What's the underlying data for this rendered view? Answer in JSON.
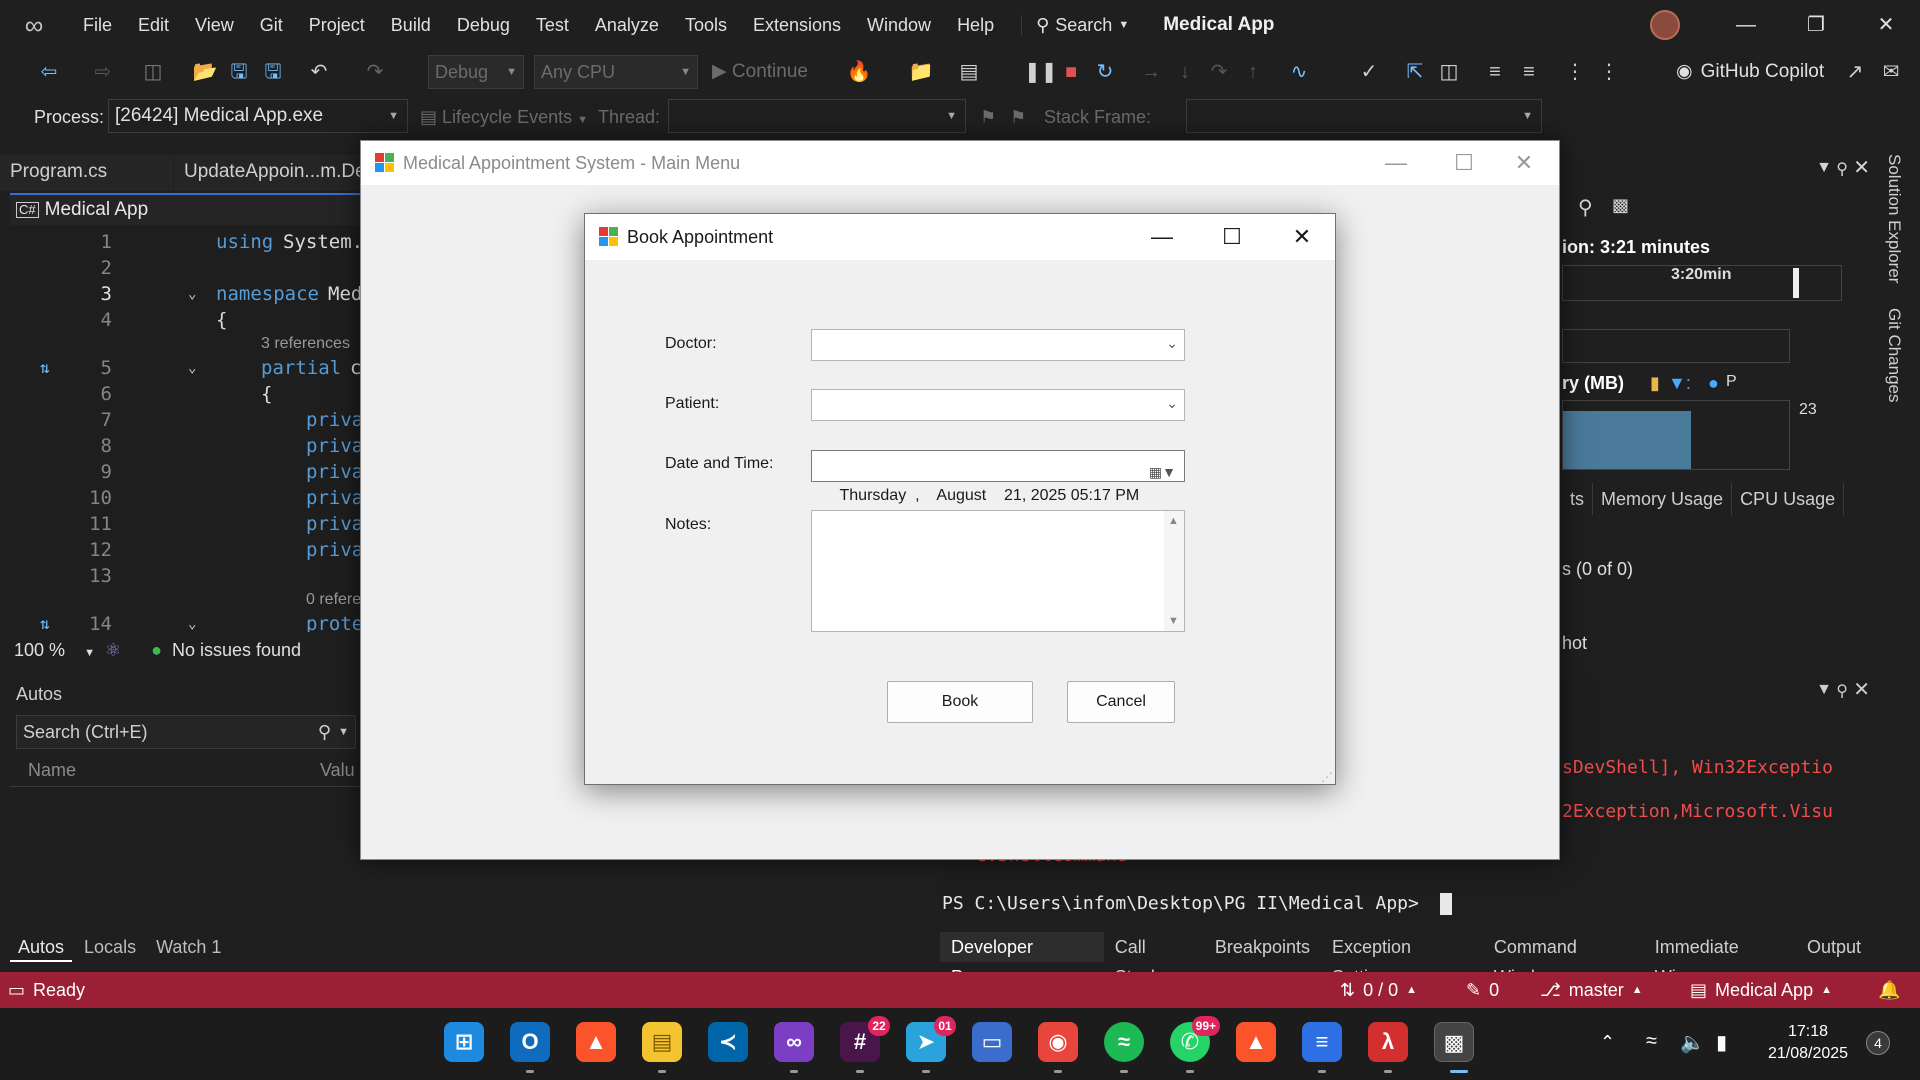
{
  "menu": {
    "items": [
      "File",
      "Edit",
      "View",
      "Git",
      "Project",
      "Build",
      "Debug",
      "Test",
      "Analyze",
      "Tools",
      "Extensions",
      "Window",
      "Help"
    ],
    "search_label": "Search",
    "solution_name": "Medical App"
  },
  "toolbar": {
    "config": "Debug",
    "platform": "Any CPU",
    "continue_label": "Continue",
    "copilot_label": "GitHub Copilot"
  },
  "processbar": {
    "process_label": "Process:",
    "process_value": "[26424] Medical App.exe",
    "lifecycle_label": "Lifecycle Events",
    "thread_label": "Thread:",
    "stack_frame_label": "Stack Frame:"
  },
  "editor": {
    "tabs": [
      "Program.cs",
      "UpdateAppoin...m.De"
    ],
    "project_nav": "Medical App",
    "lines": [
      {
        "num": "1",
        "kw": "using",
        "text": " System."
      },
      {
        "num": "2",
        "kw": "",
        "text": ""
      },
      {
        "num": "3",
        "kw": "namespace",
        "text": " Med"
      },
      {
        "num": "4",
        "kw": "",
        "text": "{"
      },
      {
        "num": "5",
        "kw": "partial",
        "text": " c"
      },
      {
        "num": "6",
        "kw": "",
        "text": "{"
      },
      {
        "num": "7",
        "kw": "priva",
        "text": ""
      },
      {
        "num": "8",
        "kw": "priva",
        "text": ""
      },
      {
        "num": "9",
        "kw": "priva",
        "text": ""
      },
      {
        "num": "10",
        "kw": "priva",
        "text": ""
      },
      {
        "num": "11",
        "kw": "priva",
        "text": ""
      },
      {
        "num": "12",
        "kw": "priva",
        "text": ""
      },
      {
        "num": "13",
        "kw": "",
        "text": ""
      },
      {
        "num": "14",
        "kw": "prote",
        "text": ""
      }
    ],
    "codelens_1": "3 references",
    "codelens_2": "0 refere",
    "zoom": "100 %",
    "issues": "No issues found"
  },
  "autos": {
    "title": "Autos",
    "search_placeholder": "Search (Ctrl+E)",
    "col_name": "Name",
    "col_value": "Valu",
    "tabs": [
      "Autos",
      "Locals",
      "Watch 1"
    ]
  },
  "diagnostics": {
    "session_text": "ion: 3:21 minutes",
    "timeline_label": "3:20min",
    "memory_label": "ry (MB)",
    "legend_p": "P",
    "memory_value": "23",
    "tabs": [
      "ts",
      "Memory Usage",
      "CPU Usage"
    ],
    "events_text": "s (0 of 0)",
    "snapshot_text": "hot",
    "rail_1": "Solution Explorer",
    "rail_2": "Git Changes"
  },
  "terminal": {
    "err_1": "sDevShell], Win32Exceptio",
    "err_2": "2Exception,Microsoft.Visu",
    "err_3": "evShellCommand",
    "prompt": "PS C:\\Users\\infom\\Desktop\\PG II\\Medical App>",
    "tabs": [
      "Developer Powe...",
      "Call Stack",
      "Breakpoints",
      "Exception Settin...",
      "Command Wind...",
      "Immediate Win...",
      "Output"
    ]
  },
  "statusbar": {
    "ready": "Ready",
    "changes": "0 / 0",
    "edits": "0",
    "branch": "master",
    "project": "Medical App"
  },
  "taskbar": {
    "badge_slack": "22",
    "badge_telegram": "01",
    "badge_whatsapp": "99+",
    "time": "17:18",
    "date": "21/08/2025",
    "notifications": "4"
  },
  "main_form": {
    "title": "Medical Appointment System - Main Menu"
  },
  "book_dialog": {
    "title": "Book Appointment",
    "doctor_label": "Doctor:",
    "doctor_value": "",
    "patient_label": "Patient:",
    "patient_value": "",
    "datetime_label": "Date and Time:",
    "datetime_value": "Thursday  ,    August    21, 2025 05:17 PM",
    "notes_label": "Notes:",
    "notes_value": "",
    "book_button": "Book",
    "cancel_button": "Cancel"
  },
  "colors": {
    "statusbar_bg": "#9b1f35",
    "keyword": "#569cd6",
    "terminal_error": "#f14c4c"
  }
}
